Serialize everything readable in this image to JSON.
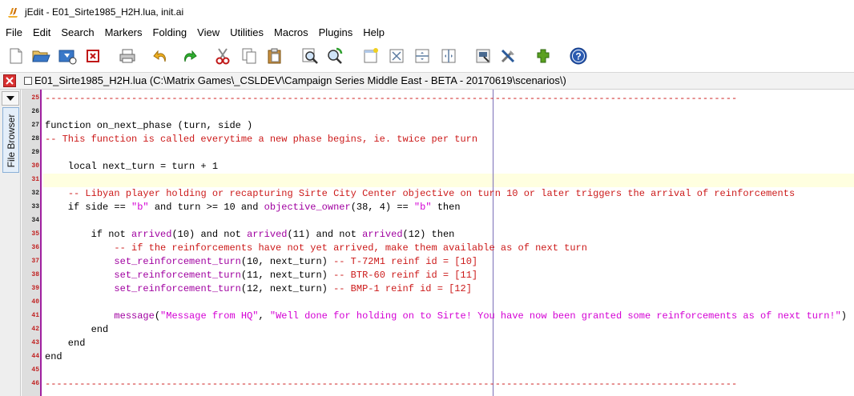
{
  "window": {
    "title": "jEdit - E01_Sirte1985_H2H.lua, init.ai"
  },
  "menu": [
    "File",
    "Edit",
    "Search",
    "Markers",
    "Folding",
    "View",
    "Utilities",
    "Macros",
    "Plugins",
    "Help"
  ],
  "toolbar": {
    "icons": [
      "new-file-icon",
      "open-file-icon",
      "reload-icon",
      "close-file-icon",
      "print-icon",
      "undo-icon",
      "redo-icon",
      "cut-icon",
      "copy-icon",
      "paste-icon",
      "find-icon",
      "find-next-icon",
      "new-view-icon",
      "unsplit-icon",
      "split-horizontal-icon",
      "split-vertical-icon",
      "global-options-icon",
      "plugin-options-icon",
      "plugin-manager-icon",
      "help-icon"
    ]
  },
  "buffer": {
    "title": "E01_Sirte1985_H2H.lua (C:\\Matrix Games\\_CSLDEV\\Campaign Series Middle East - BETA - 20170619\\scenarios\\)"
  },
  "sidebar": {
    "tab_label": "File Browser"
  },
  "editor": {
    "line_numbers": [
      "25",
      "26",
      "27",
      "28",
      "29",
      "30",
      "31",
      "32",
      "33",
      "34",
      "35",
      "36",
      "37",
      "38",
      "39",
      "40",
      "41",
      "42",
      "43",
      "44",
      "45",
      "46"
    ],
    "lines": [
      "------------------------------------------------------------------------------------------------------------------------",
      "",
      "function on_next_phase (turn, side )",
      "-- This function is called everytime a new phase begins, ie. twice per turn",
      "",
      "    local next_turn = turn + 1",
      "",
      "    -- Libyan player holding or recapturing Sirte City Center objective on turn 10 or later triggers the arrival of reinforcements",
      "    if side == \"b\" and turn >= 10 and objective_owner(38, 4) == \"b\" then",
      "",
      "        if not arrived(10) and not arrived(11) and not arrived(12) then",
      "            -- if the reinforcements have not yet arrived, make them available as of next turn",
      "            set_reinforcement_turn(10, next_turn) -- T-72M1 reinf id = [10]",
      "            set_reinforcement_turn(11, next_turn) -- BTR-60 reinf id = [11]",
      "            set_reinforcement_turn(12, next_turn) -- BMP-1 reinf id = [12]",
      "",
      "            message(\"Message from HQ\", \"Well done for holding on to Sirte! You have now been granted some reinforcements as of next turn!\")",
      "        end",
      "    end",
      "end",
      "",
      "------------------------------------------------------------------------------------------------------------------------"
    ]
  }
}
